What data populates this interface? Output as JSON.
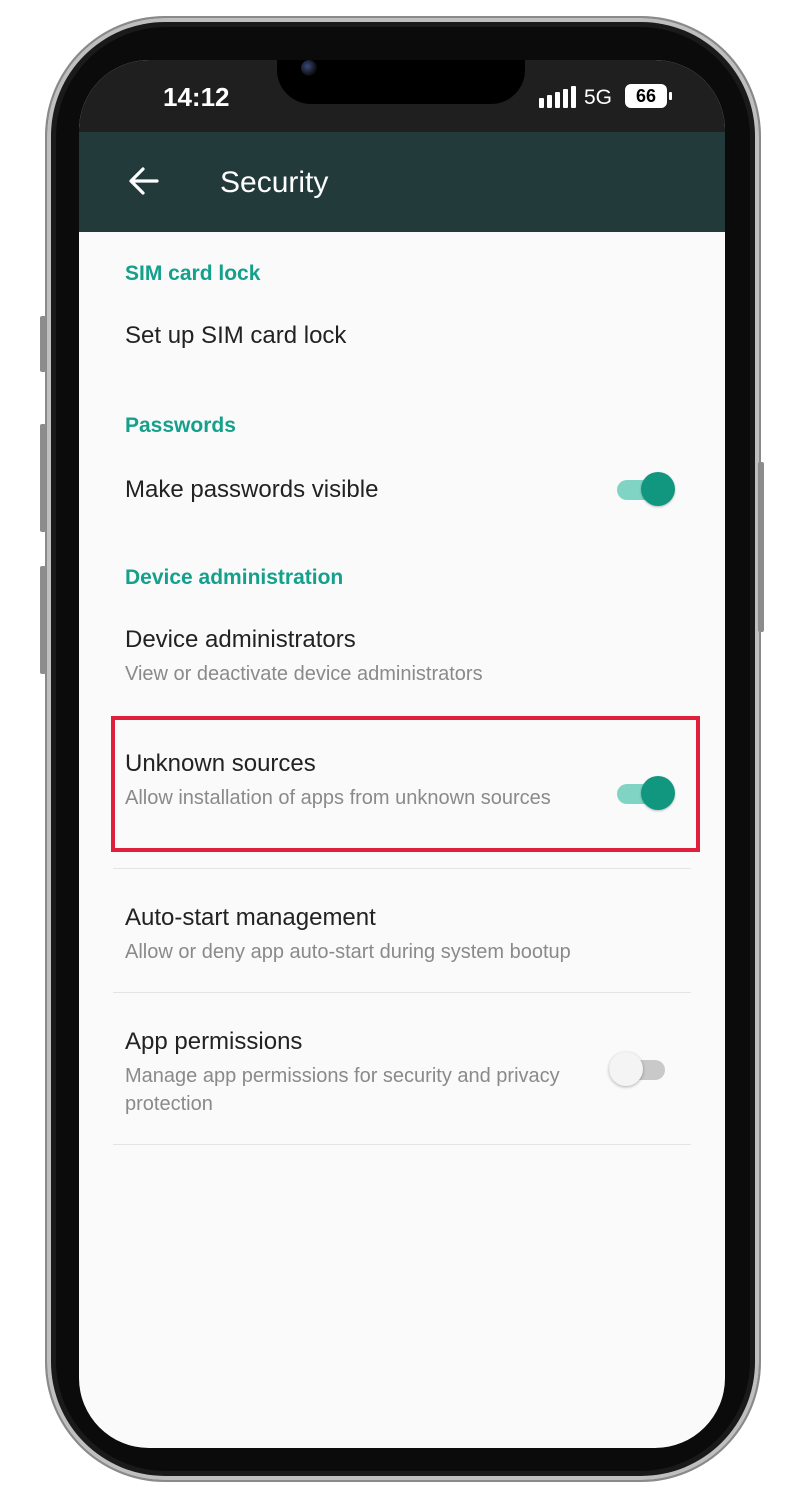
{
  "status_bar": {
    "time": "14:12",
    "network": "5G",
    "battery": "66"
  },
  "app_bar": {
    "back_icon": "arrow-left-icon",
    "title": "Security"
  },
  "sections": [
    {
      "header": "SIM card lock"
    },
    {
      "header": "Passwords"
    },
    {
      "header": "Device administration"
    }
  ],
  "rows": {
    "sim_lock": {
      "title": "Set up SIM card lock"
    },
    "passwords_visible": {
      "title": "Make passwords visible",
      "toggle": "on"
    },
    "device_admins": {
      "title": "Device administrators",
      "subtitle": "View or deactivate device administrators"
    },
    "unknown_sources": {
      "title": "Unknown sources",
      "subtitle": "Allow installation of apps from unknown sources",
      "toggle": "on"
    },
    "auto_start": {
      "title": "Auto-start management",
      "subtitle": "Allow or deny app auto-start during system bootup"
    },
    "app_permissions": {
      "title": "App permissions",
      "subtitle": "Manage app permissions for security and privacy protection",
      "toggle": "off"
    }
  },
  "colors": {
    "accent": "#14a08b",
    "app_bar": "#233a3b",
    "highlight": "#e0203a"
  }
}
